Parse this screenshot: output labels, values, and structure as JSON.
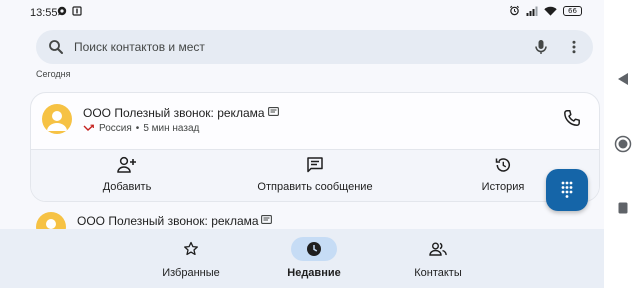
{
  "status_bar": {
    "time": "13:55",
    "battery": "66",
    "icons": [
      "whatsapp-icon",
      "notification-icon",
      "alarm-icon",
      "signal-icon",
      "wifi-icon",
      "battery-icon"
    ]
  },
  "search": {
    "placeholder": "Поиск контактов и мест",
    "icons": [
      "search-icon",
      "mic-icon",
      "more-vert-icon"
    ]
  },
  "section_label": "Сегодня",
  "calls": [
    {
      "name": "ООО Полезный звонок: реклама",
      "country": "Россия",
      "time_ago": "5 мин назад",
      "direction_icon": "missed-call-icon",
      "badge_icon": "sms-icon"
    },
    {
      "name": "ООО Полезный звонок: реклама",
      "badge_icon": "sms-icon"
    }
  ],
  "card_actions": {
    "add": "Добавить",
    "message": "Отправить сообщение",
    "history": "История"
  },
  "bottom_nav": {
    "favorites": "Избранные",
    "recents": "Недавние",
    "contacts": "Контакты",
    "active": "recents"
  },
  "colors": {
    "accent": "#1565a8",
    "avatar": "#f6c244",
    "active_pill": "#c6dcf5",
    "search_bg": "#e6ebf3",
    "nav_bg": "#e9eef6",
    "missed": "#c5221f"
  }
}
